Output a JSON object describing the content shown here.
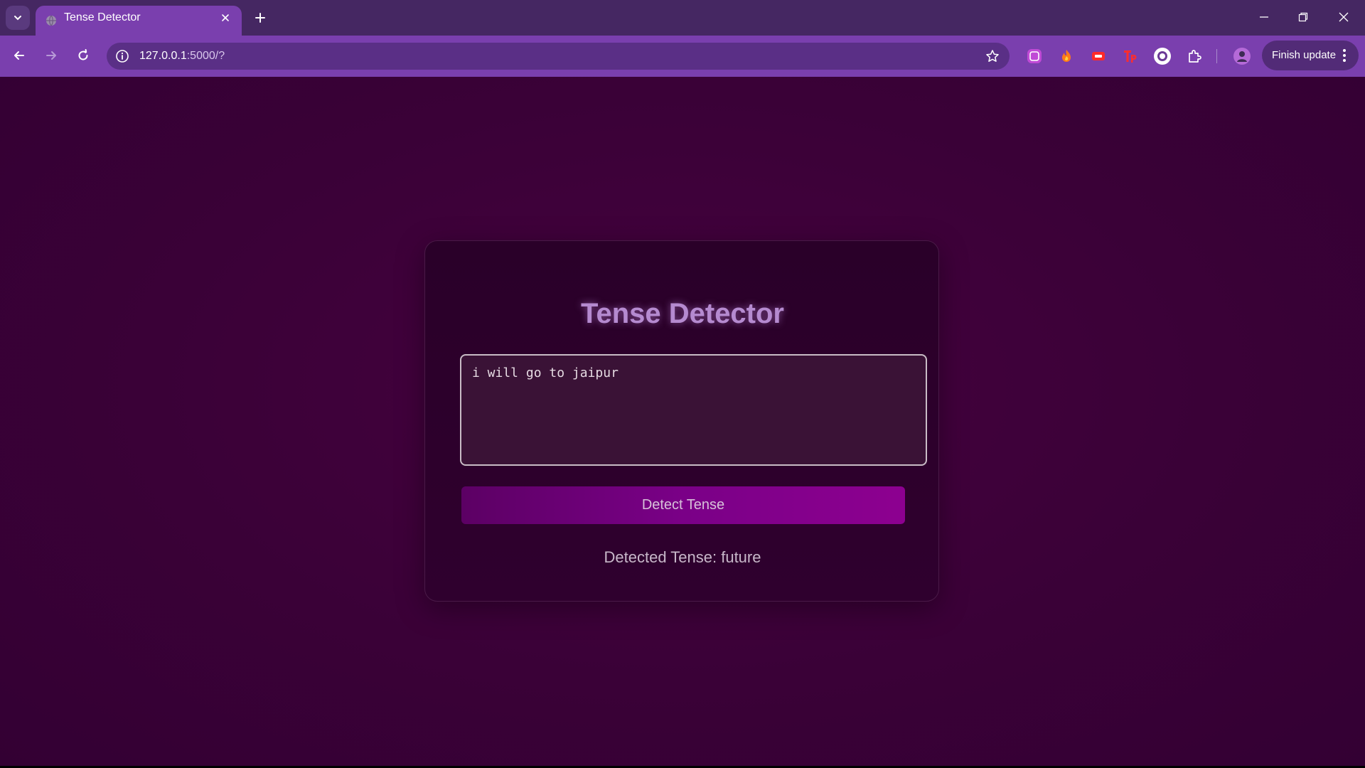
{
  "browser": {
    "tab_title": "Tense Detector",
    "url_host": "127.0.0.1",
    "url_path": ":5000/?",
    "finish_update_label": "Finish update"
  },
  "icons": {
    "tab_search": "chevron-down-icon",
    "favicon": "globe-icon",
    "tab_close": "close-icon",
    "new_tab": "plus-icon",
    "back": "arrow-left-icon",
    "forward": "arrow-right-icon",
    "reload": "reload-icon",
    "site_info": "info-icon",
    "bookmark": "star-icon",
    "extensions": [
      "language-reactor-icon",
      "fire-icon",
      "youtube-icon",
      "tp-icon",
      "record-icon",
      "puzzle-icon"
    ],
    "profile": "avatar-icon",
    "menu": "kebab-menu-icon",
    "window": [
      "minimize-icon",
      "restore-icon",
      "close-window-icon"
    ]
  },
  "app": {
    "title": "Tense Detector",
    "input_value": "i will go to jaipur",
    "button_label": "Detect Tense",
    "result_label": "Detected Tense:",
    "result_value": "future"
  },
  "colors": {
    "page_background": "#3a0137",
    "card_background": "#2c002b",
    "title": "#b58ad0",
    "button": "#7a0087",
    "browser_frame": "#452762",
    "toolbar": "#7a3fae"
  }
}
